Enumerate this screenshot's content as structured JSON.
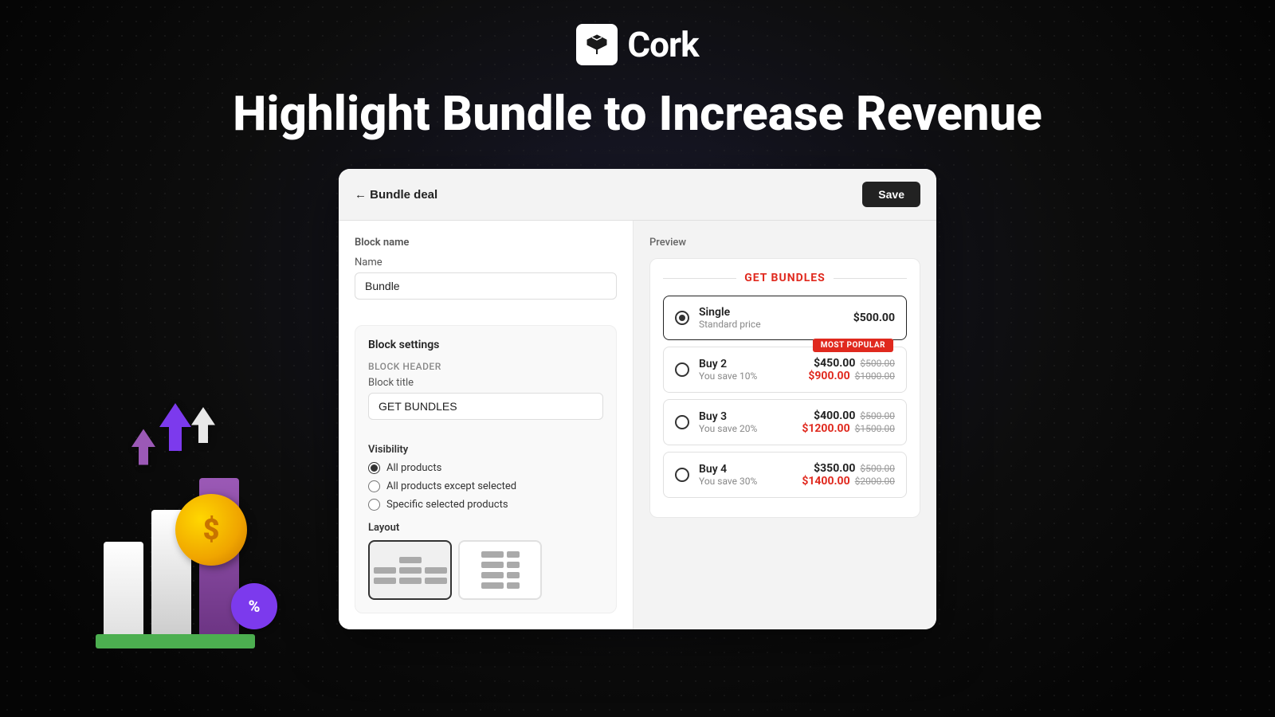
{
  "logo": {
    "text": "Cork"
  },
  "hero": {
    "title": "Highlight Bundle to Increase Revenue"
  },
  "card": {
    "header": {
      "back_label": "← Bundle deal",
      "save_label": "Save"
    },
    "left_panel": {
      "block_name_label": "Block name",
      "name_label": "Name",
      "name_value": "Bundle",
      "block_settings_label": "Block settings",
      "block_header_label": "Block header",
      "block_title_label": "Block title",
      "block_title_value": "GET BUNDLES",
      "visibility_label": "Visibility",
      "radio_options": [
        {
          "id": "all",
          "label": "All products",
          "checked": true
        },
        {
          "id": "except",
          "label": "All products except selected",
          "checked": false
        },
        {
          "id": "specific",
          "label": "Specific selected products",
          "checked": false
        }
      ],
      "layout_label": "Layout"
    },
    "preview": {
      "label": "Preview",
      "bundles_title": "GET BUNDLES",
      "items": [
        {
          "name": "Single",
          "sub": "Standard price",
          "price_new": "$500.00",
          "price_old": "",
          "price_old2": "",
          "selected": true,
          "badge": ""
        },
        {
          "name": "Buy 2",
          "sub": "You save 10%",
          "price_new": "$450.00",
          "price_old": "$500.00",
          "price_new2": "$900.00",
          "price_old2": "$1000.00",
          "selected": false,
          "badge": "MOST POPULAR"
        },
        {
          "name": "Buy 3",
          "sub": "You save 20%",
          "price_new": "$400.00",
          "price_old": "$500.00",
          "price_new2": "$1200.00",
          "price_old2": "$1500.00",
          "selected": false,
          "badge": ""
        },
        {
          "name": "Buy 4",
          "sub": "You save 30%",
          "price_new": "$350.00",
          "price_old": "$500.00",
          "price_new2": "$1400.00",
          "price_old2": "$2000.00",
          "selected": false,
          "badge": ""
        }
      ]
    }
  },
  "decorative": {
    "coin_symbol": "$",
    "percent_symbol": "%"
  }
}
